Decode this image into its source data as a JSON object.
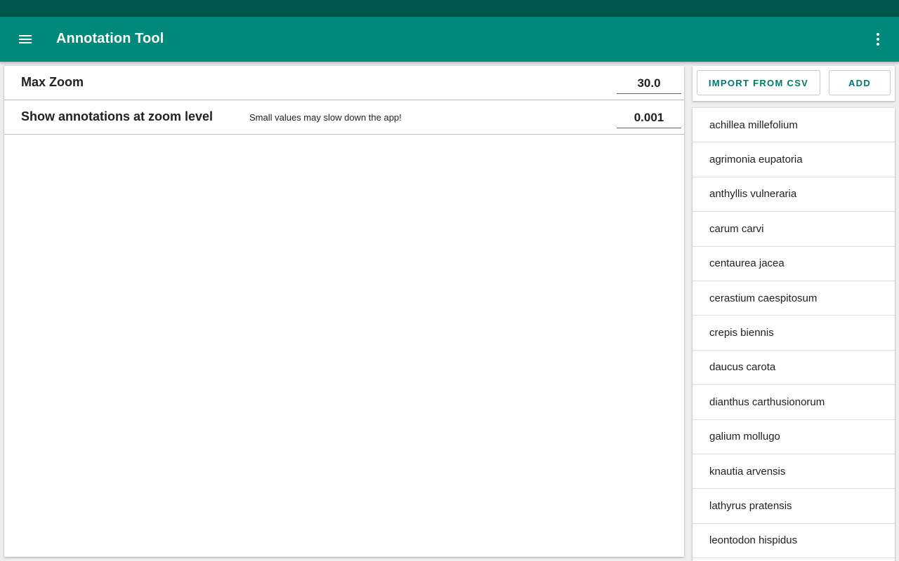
{
  "app": {
    "title": "Annotation Tool",
    "menu_icon": "menu-icon",
    "overflow_icon": "more-vert-icon",
    "colors": {
      "status_bar": "#00574b",
      "app_bar": "#00897b",
      "accent_text": "#00796b"
    }
  },
  "settings": {
    "max_zoom": {
      "label": "Max Zoom",
      "value": "30.0"
    },
    "annotation_zoom": {
      "label": "Show annotations at zoom level",
      "hint": "Small values may slow down the app!",
      "value": "0.001"
    }
  },
  "actions": {
    "import_label": "IMPORT FROM CSV",
    "add_label": "ADD"
  },
  "species": [
    "achillea millefolium",
    "agrimonia eupatoria",
    "anthyllis vulneraria",
    "carum carvi",
    "centaurea jacea",
    "cerastium caespitosum",
    "crepis biennis",
    "daucus carota",
    "dianthus carthusionorum",
    "galium mollugo",
    "knautia arvensis",
    "lathyrus pratensis",
    "leontodon hispidus"
  ]
}
